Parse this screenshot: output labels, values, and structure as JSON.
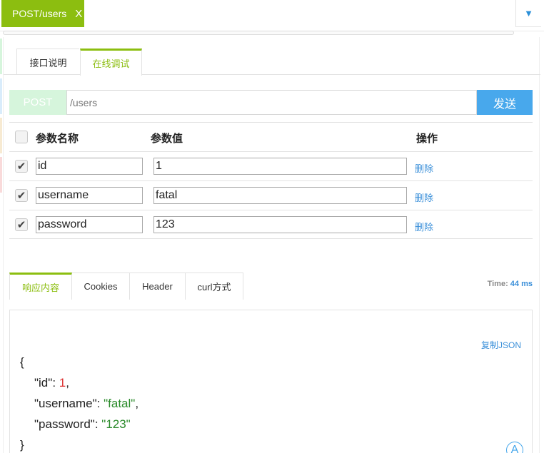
{
  "top_tab": {
    "label": "POST/users",
    "close": "X"
  },
  "dropdown_icon": "▼",
  "doc_tabs": [
    "接口说明",
    "在线调试"
  ],
  "request": {
    "method": "POST",
    "url": "/users",
    "send_label": "发送"
  },
  "params": {
    "headers": {
      "name": "参数名称",
      "value": "参数值",
      "action": "操作"
    },
    "rows": [
      {
        "checked": true,
        "name": "id",
        "value": "1",
        "action": "删除"
      },
      {
        "checked": true,
        "name": "username",
        "value": "fatal",
        "action": "删除"
      },
      {
        "checked": true,
        "name": "password",
        "value": "123",
        "action": "删除"
      }
    ]
  },
  "response_tabs": [
    "响应内容",
    "Cookies",
    "Header",
    "curl方式"
  ],
  "time": {
    "label": "Time:",
    "value": "44 ms"
  },
  "response": {
    "copy_label": "复制JSON",
    "open_brace": "{",
    "close_brace": "}",
    "fields": [
      {
        "key": "\"id\"",
        "value": "1",
        "comma": ","
      },
      {
        "key": "\"username\"",
        "value": "\"fatal\"",
        "comma": ","
      },
      {
        "key": "\"password\"",
        "value": "\"123\"",
        "comma": ""
      }
    ],
    "floating_icon": "A"
  },
  "colors": {
    "accent_green": "#8cbe10",
    "link_blue": "#3a8fd9",
    "send_blue": "#48a8ec"
  }
}
